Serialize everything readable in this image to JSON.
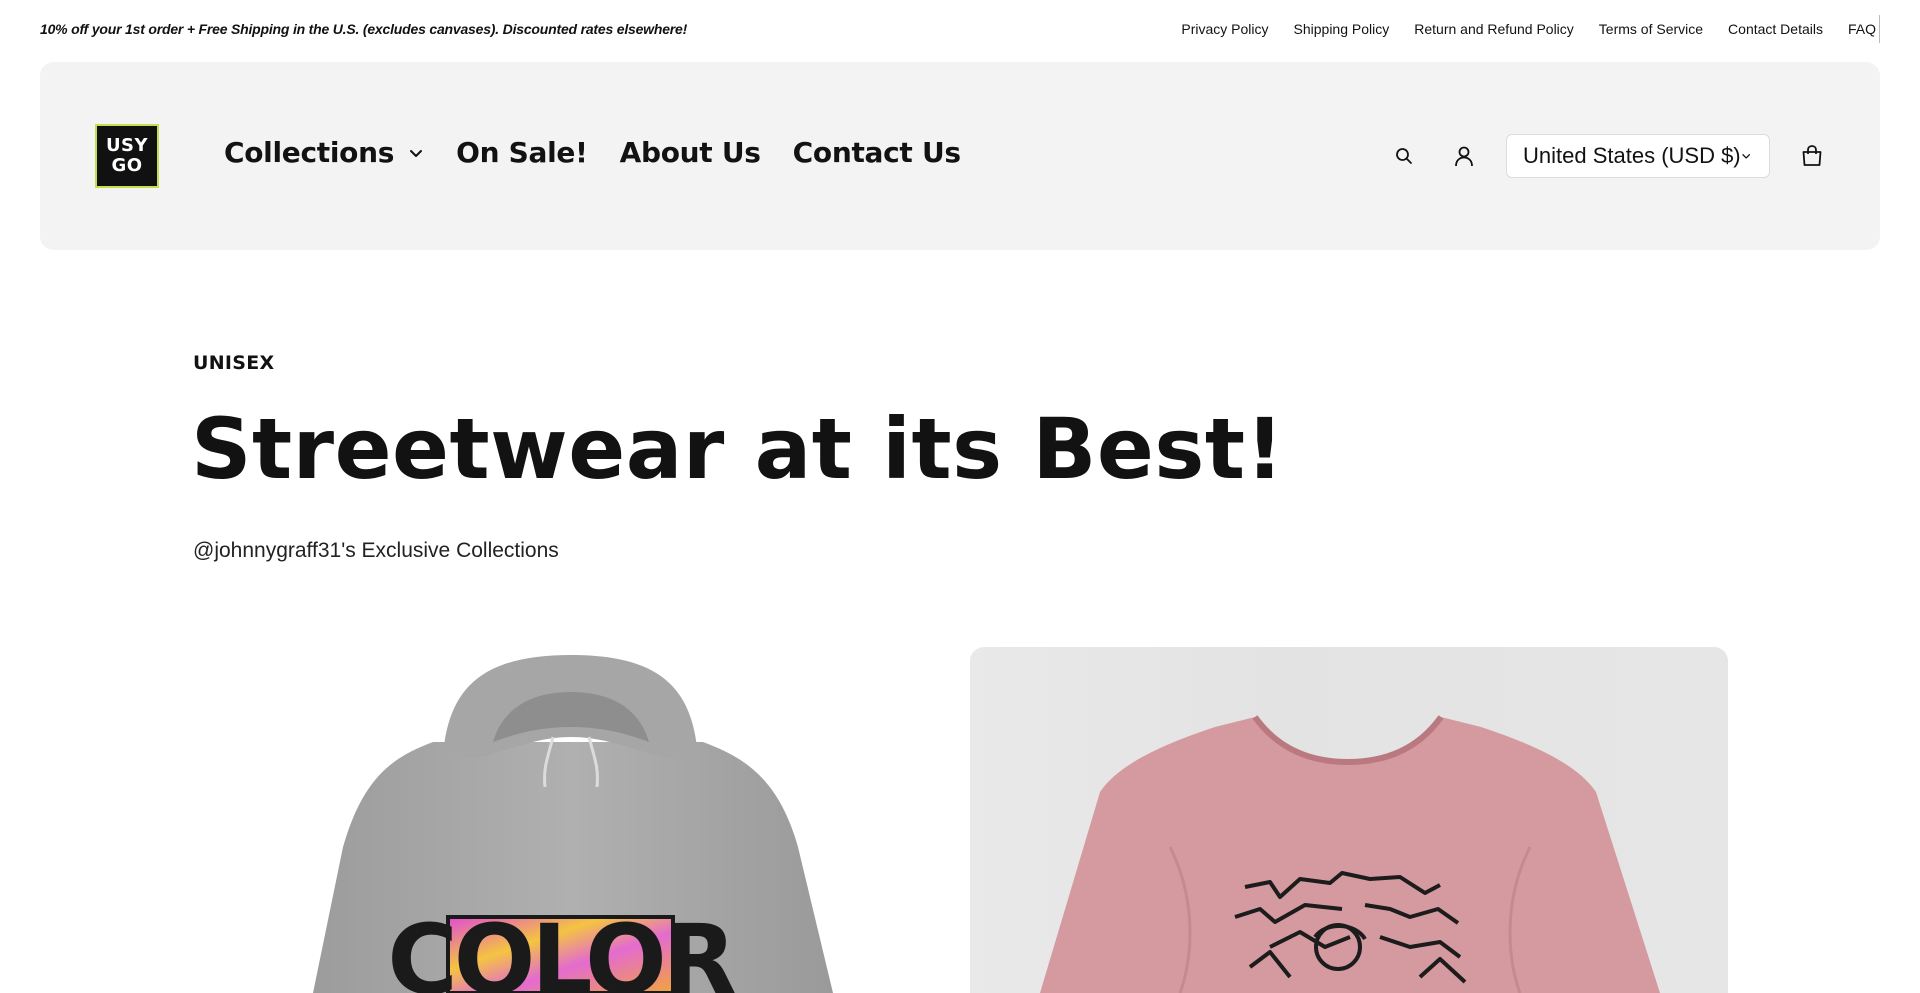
{
  "announcement": {
    "text": "10% off your 1st order + Free Shipping in the U.S. (excludes canvases). Discounted rates elsewhere!",
    "links": [
      "Privacy Policy",
      "Shipping Policy",
      "Return and Refund Policy",
      "Terms of Service",
      "Contact Details",
      "FAQ"
    ]
  },
  "header": {
    "logo": {
      "line1": "USY",
      "line2": "GO"
    },
    "nav": [
      {
        "label": "Collections",
        "has_dropdown": true
      },
      {
        "label": "On Sale!"
      },
      {
        "label": "About Us"
      },
      {
        "label": "Contact Us"
      }
    ],
    "icons": [
      "search-icon",
      "account-icon",
      "cart-icon"
    ],
    "country_selector": "United States (USD $)"
  },
  "hero": {
    "eyebrow": "UNISEX",
    "title": "Streetwear at its Best!",
    "subtitle": "@johnnygraff31's Exclusive Collections"
  },
  "products": [
    {
      "image": "grey-hoodie",
      "print_text": "COLOR"
    },
    {
      "image": "pink-tshirt"
    }
  ],
  "colors": {
    "header_bg": "#f3f3f3",
    "text": "#121212",
    "logo_accent": "#c9dc4f",
    "hoodie": "#a9a9a9",
    "tshirt": "#d49aa0"
  }
}
